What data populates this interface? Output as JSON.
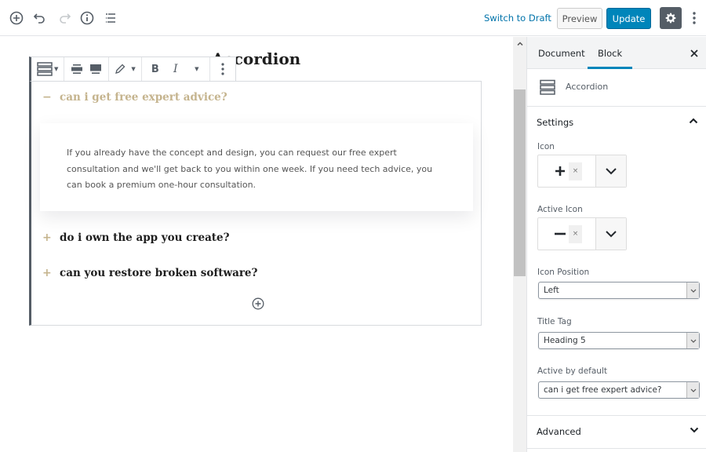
{
  "topbar": {
    "left_icons": [
      "add-block-icon",
      "undo-icon",
      "redo-icon",
      "info-icon",
      "outline-icon"
    ],
    "switch_to_draft": "Switch to Draft",
    "preview": "Preview",
    "update": "Update",
    "settings_icon": "gear-icon",
    "more_icon": "more-vertical-icon"
  },
  "editor": {
    "post_title": "Accordion",
    "toolbar": {
      "italic": "I",
      "bold": "B"
    },
    "accordion": {
      "items": [
        {
          "title": "can i get free expert advice?",
          "sign": "−",
          "active": true,
          "content": "If you already have the concept and design, you can request our free expert consultation and we'll get back to you within one week. If you need tech advice, you can book a premium one-hour consultation."
        },
        {
          "title": "do i own the app you create?",
          "sign": "+",
          "active": false
        },
        {
          "title": "can you restore broken software?",
          "sign": "+",
          "active": false
        }
      ]
    }
  },
  "sidebar": {
    "tabs": [
      {
        "label": "Document",
        "active": false
      },
      {
        "label": "Block",
        "active": true
      }
    ],
    "block_name": "Accordion",
    "settings": {
      "title": "Settings",
      "icon_label": "Icon",
      "icon_value": "plus",
      "active_icon_label": "Active Icon",
      "active_icon_value": "minus",
      "remove_glyph": "×",
      "icon_position_label": "Icon Position",
      "icon_position_value": "Left",
      "title_tag_label": "Title Tag",
      "title_tag_value": "Heading 5",
      "active_default_label": "Active by default",
      "active_default_value": "can i get free expert advice?"
    },
    "advanced": {
      "title": "Advanced"
    }
  },
  "colors": {
    "accent": "#0085ba",
    "link": "#0073aa",
    "accordion_accent": "#c5b48e",
    "settings_button": "#555d66"
  }
}
